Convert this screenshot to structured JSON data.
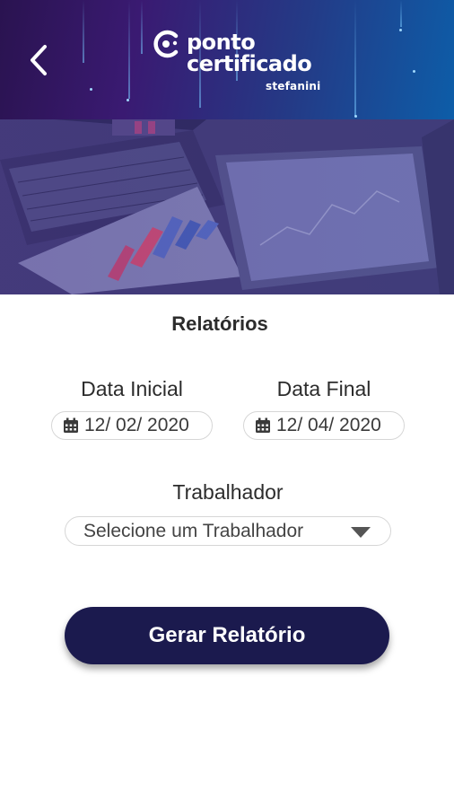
{
  "header": {
    "brand_line1": "ponto",
    "brand_line2": "certificado",
    "brand_sub": "stefanini",
    "back_icon": "chevron-left-icon"
  },
  "page": {
    "title": "Relatórios"
  },
  "form": {
    "start_label": "Data Inicial",
    "start_value": "12/ 02/ 2020",
    "end_label": "Data Final",
    "end_value": "12/ 04/ 2020",
    "worker_label": "Trabalhador",
    "worker_value": "Selecione um Trabalhador",
    "submit_label": "Gerar Relatório"
  },
  "colors": {
    "button": "#1b1a4e",
    "header_start": "#2a1350",
    "header_end": "#0d5da8"
  }
}
